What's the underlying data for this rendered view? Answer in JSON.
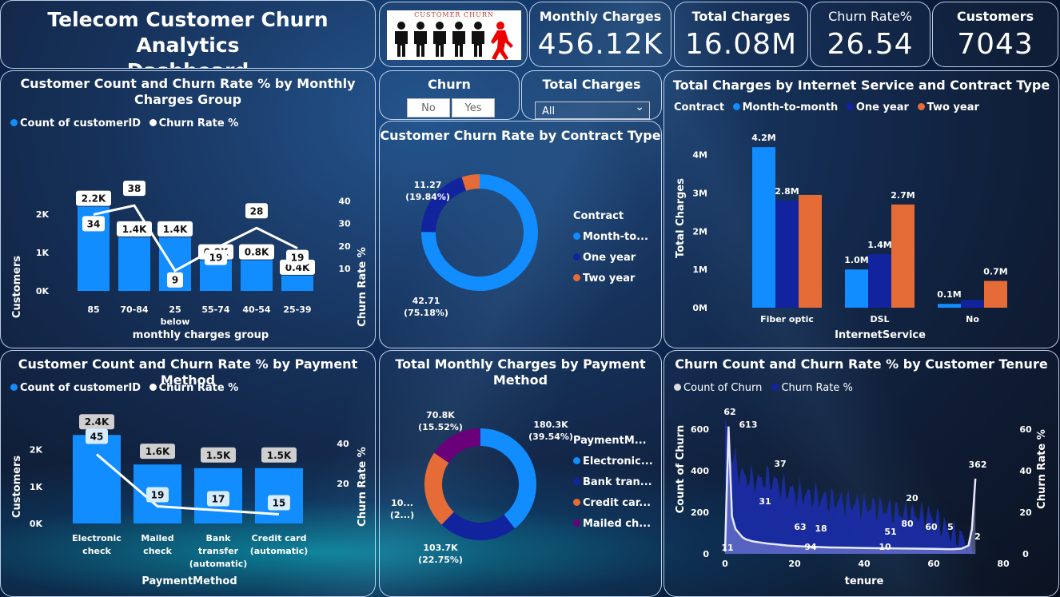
{
  "header": {
    "title_line1": "Telecom Customer Churn Analytics",
    "title_line2": "Dashboard",
    "logo_text": "CUSTOMER CHURN"
  },
  "kpis": [
    {
      "label": "Monthly Charges",
      "value": "456.12K"
    },
    {
      "label": "Total Charges",
      "value": "16.08M"
    },
    {
      "label": "Churn Rate%",
      "value": "26.54"
    },
    {
      "label": "Customers",
      "value": "7043"
    }
  ],
  "colors": {
    "blue": "#118dff",
    "navy": "#12239e",
    "orange": "#e66c37",
    "purple": "#6b007b",
    "white": "#ffffff"
  },
  "slicers": {
    "churn": {
      "title": "Churn",
      "options": [
        "No",
        "Yes"
      ]
    },
    "total_charges": {
      "title": "Total Charges",
      "selected": "All"
    }
  },
  "chart_monthly_group": {
    "title": "Customer Count and Churn Rate % by Monthly Charges Group",
    "legend": [
      "Count of customerID",
      "Churn Rate %"
    ],
    "xlabel": "monthly charges group",
    "ylabel": "Customers",
    "y2label": "Churn Rate %",
    "y_ticks": [
      "0K",
      "1K",
      "2K"
    ],
    "y2_ticks": [
      "10",
      "20",
      "30",
      "40"
    ]
  },
  "chart_payment": {
    "title": "Customer Count and Churn Rate % by Payment Method",
    "legend": [
      "Count of customerID",
      "Churn Rate %"
    ],
    "xlabel": "PaymentMethod",
    "ylabel": "Customers",
    "y2label": "Churn Rate %",
    "y_ticks": [
      "0K",
      "1K",
      "2K"
    ],
    "y2_ticks": [
      "20",
      "40"
    ]
  },
  "chart_contract_donut": {
    "title": "Customer Churn Rate by Contract Type",
    "legend_title": "Contract",
    "legend": [
      "Month-to...",
      "One year",
      "Two year"
    ]
  },
  "chart_payment_donut": {
    "title": "Total Monthly Charges by Payment Method",
    "legend_title": "PaymentM...",
    "legend": [
      "Electronic...",
      "Bank tran...",
      "Credit car...",
      "Mailed ch..."
    ]
  },
  "chart_internet": {
    "title": "Total Charges by Internet Service and Contract Type",
    "legend_title": "Contract",
    "legend": [
      "Month-to-month",
      "One year",
      "Two year"
    ],
    "xlabel": "InternetService",
    "ylabel": "Total Charges",
    "y_ticks": [
      "0M",
      "1M",
      "2M",
      "3M",
      "4M"
    ]
  },
  "chart_tenure": {
    "title": "Churn Count and Churn Rate % by Customer Tenure",
    "legend": [
      "Count of Churn",
      "Churn Rate %"
    ],
    "xlabel": "tenure",
    "ylabel": "Count of Churn",
    "y2label": "Churn Rate %",
    "y_ticks": [
      "0",
      "200",
      "400",
      "600"
    ],
    "y2_ticks": [
      "0",
      "20",
      "40",
      "60"
    ],
    "x_ticks": [
      "0",
      "20",
      "40",
      "60",
      "80"
    ]
  },
  "chart_data": [
    {
      "type": "bar",
      "title": "Customer Count and Churn Rate % by Monthly Charges Group",
      "categories": [
        "85",
        "70-84",
        "25 below",
        "55-74",
        "40-54",
        "25-39"
      ],
      "series": [
        {
          "name": "Count of customerID",
          "values": [
            2200,
            1400,
            1400,
            800,
            800,
            400
          ],
          "labels": [
            "2.2K",
            "1.4K",
            "1.4K",
            "0.8K",
            "0.8K",
            "0.4K"
          ]
        },
        {
          "name": "Churn Rate %",
          "values": [
            34,
            38,
            9,
            19,
            28,
            19
          ],
          "labels": [
            "34",
            "38",
            "9",
            "19",
            "28",
            "19"
          ]
        }
      ],
      "xlabel": "monthly charges group",
      "ylabel": "Customers",
      "y2label": "Churn Rate %",
      "ylim": [
        0,
        2400
      ],
      "y2lim": [
        0,
        45
      ]
    },
    {
      "type": "pie",
      "title": "Customer Churn Rate by Contract Type",
      "categories": [
        "Month-to-month",
        "One year",
        "Two year"
      ],
      "values": [
        42.71,
        11.27,
        2.83
      ],
      "labels": [
        "42.71\n(75.18%)",
        "11.27\n(19.84%)",
        ""
      ],
      "label_lines": [
        [
          "42.71",
          "(75.18%)"
        ],
        [
          "11.27",
          "(19.84%)"
        ]
      ]
    },
    {
      "type": "bar",
      "title": "Total Charges by Internet Service and Contract Type",
      "categories": [
        "Fiber optic",
        "DSL",
        "No"
      ],
      "series": [
        {
          "name": "Month-to-month",
          "values": [
            4.2,
            1.0,
            0.1
          ],
          "labels": [
            "4.2M",
            "1.0M",
            "0.1M"
          ]
        },
        {
          "name": "One year",
          "values": [
            2.8,
            1.4,
            0.2
          ],
          "labels": [
            "2.8M",
            "1.4M",
            ""
          ]
        },
        {
          "name": "Two year",
          "values": [
            2.95,
            2.7,
            0.7
          ],
          "labels": [
            "",
            "2.7M",
            "0.7M"
          ]
        }
      ],
      "xlabel": "InternetService",
      "ylabel": "Total Charges",
      "ylim": [
        0,
        4.6
      ]
    },
    {
      "type": "bar",
      "title": "Customer Count and Churn Rate % by Payment Method",
      "categories": [
        "Electronic check",
        "Mailed check",
        "Bank transfer (automatic)",
        "Credit card (automatic)"
      ],
      "series": [
        {
          "name": "Count of customerID",
          "values": [
            2400,
            1600,
            1500,
            1500
          ],
          "labels": [
            "2.4K",
            "1.6K",
            "1.5K",
            "1.5K"
          ]
        },
        {
          "name": "Churn Rate %",
          "values": [
            45,
            19,
            17,
            15
          ],
          "labels": [
            "45",
            "19",
            "17",
            "15"
          ]
        }
      ],
      "xlabel": "PaymentMethod",
      "ylabel": "Customers",
      "y2label": "Churn Rate %",
      "ylim": [
        0,
        2600
      ],
      "y2lim": [
        0,
        48
      ]
    },
    {
      "type": "pie",
      "title": "Total Monthly Charges by Payment Method",
      "categories": [
        "Electronic check",
        "Bank transfer (automatic)",
        "Credit card (automatic)",
        "Mailed check"
      ],
      "values": [
        180.3,
        103.7,
        101.9,
        70.8
      ],
      "labels": [
        "180.3K\n(39.54%)",
        "103.7K\n(22.75%)",
        "10...\n(2...)",
        "70.8K\n(15.52%)"
      ],
      "label_lines": [
        [
          "180.3K",
          "(39.54%)"
        ],
        [
          "103.7K",
          "(22.75%)"
        ],
        [
          "10...",
          "(2...)"
        ],
        [
          "70.8K",
          "(15.52%)"
        ]
      ]
    },
    {
      "type": "area",
      "title": "Churn Count and Churn Rate % by Customer Tenure",
      "x": [
        0,
        1,
        2,
        3,
        4,
        5,
        6,
        8,
        10,
        12,
        15,
        18,
        20,
        22,
        25,
        28,
        30,
        35,
        40,
        45,
        50,
        55,
        60,
        65,
        68,
        70,
        71,
        72
      ],
      "series": [
        {
          "name": "Count of Churn",
          "values": [
            11,
            613,
            180,
            120,
            100,
            80,
            70,
            60,
            55,
            50,
            45,
            40,
            38,
            36,
            34,
            32,
            31,
            30,
            28,
            27,
            26,
            25,
            24,
            22,
            25,
            40,
            120,
            362
          ]
        },
        {
          "name": "Churn Rate %",
          "values": [
            62,
            55,
            48,
            44,
            40,
            38,
            37,
            36,
            35,
            37,
            34,
            31,
            30,
            29,
            28,
            27,
            26,
            25,
            23,
            22,
            20,
            19,
            18,
            10,
            8,
            5,
            3,
            2
          ]
        }
      ],
      "point_labels": [
        "62",
        "613",
        "37",
        "31",
        "63",
        "18",
        "94",
        "51",
        "10",
        "80",
        "20",
        "60",
        "5",
        "362",
        "2",
        "11"
      ],
      "xlabel": "tenure",
      "ylabel": "Count of Churn",
      "y2label": "Churn Rate %",
      "xlim": [
        0,
        80
      ],
      "ylim": [
        0,
        650
      ],
      "y2lim": [
        0,
        65
      ]
    }
  ]
}
